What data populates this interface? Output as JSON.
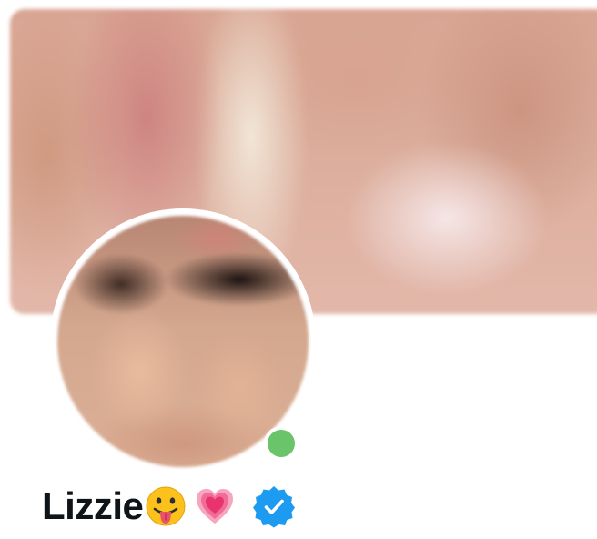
{
  "profile": {
    "display_name": "Lizzie",
    "emojis": [
      "face-with-tongue",
      "growing-heart"
    ],
    "verified": true,
    "online": true
  },
  "icons": {
    "verified": "verified-badge-icon",
    "status": "online-status-icon"
  },
  "colors": {
    "verified_blue": "#1d9bf0",
    "online_green": "#6ac46a",
    "name_text": "#0f1419",
    "background": "#ffffff"
  }
}
